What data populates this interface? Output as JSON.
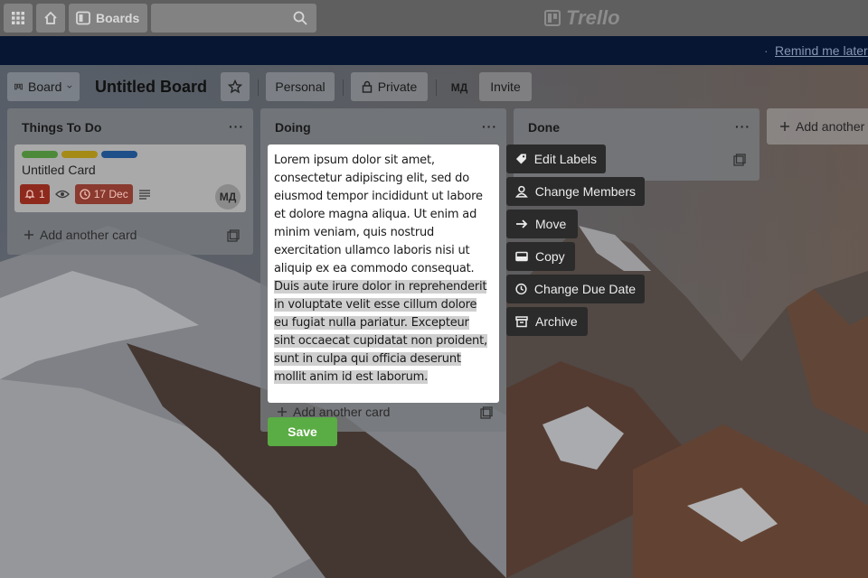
{
  "header": {
    "apps_icon": "grid-icon",
    "home_icon": "home-icon",
    "boards_label": "Boards",
    "search_placeholder": "",
    "logo_text": "Trello"
  },
  "banner": {
    "separator": "·",
    "remind_label": "Remind me later"
  },
  "board": {
    "switcher_label": "Board",
    "title": "Untitled Board",
    "personal_label": "Personal",
    "private_label": "Private",
    "member_initials": "МД",
    "invite_label": "Invite"
  },
  "lists": [
    {
      "title": "Things To Do",
      "menu": "···",
      "add_card_label": "Add another card",
      "card": {
        "title": "Untitled Card",
        "labels": [
          "#4c8a3a",
          "#a58a15",
          "#1e4f88"
        ],
        "notification_count": "1",
        "due_date": "17 Dec",
        "member_initials": "МД"
      }
    },
    {
      "title": "Doing",
      "menu": "···",
      "add_card_label": "Add another card"
    },
    {
      "title": "Done",
      "menu": "···",
      "add_card_label": ""
    }
  ],
  "add_list_label": "Add another",
  "editor": {
    "text_plain": "Lorem ipsum dolor sit amet, consectetur adipiscing elit, sed do eiusmod tempor incididunt ut labore et dolore magna aliqua. Ut enim ad minim veniam, quis nostrud exercitation ullamco laboris nisi ut aliquip ex ea commodo consequat.",
    "text_selected": "Duis aute irure dolor in reprehenderit in voluptate velit esse cillum dolore eu fugiat nulla pariatur. Excepteur sint occaecat cupidatat non proident, sunt in culpa qui officia deserunt mollit anim id est laborum.",
    "save_label": "Save"
  },
  "quick_actions": [
    {
      "label": "Edit Labels",
      "icon": "tag-icon"
    },
    {
      "label": "Change Members",
      "icon": "person-icon"
    },
    {
      "label": "Move",
      "icon": "arrow-right-icon"
    },
    {
      "label": "Copy",
      "icon": "card-icon"
    },
    {
      "label": "Change Due Date",
      "icon": "clock-icon"
    },
    {
      "label": "Archive",
      "icon": "archive-icon"
    }
  ],
  "colors": {
    "banner": "#061633",
    "save": "#5aac44",
    "quick_action_bg": "#2b2b2b"
  }
}
